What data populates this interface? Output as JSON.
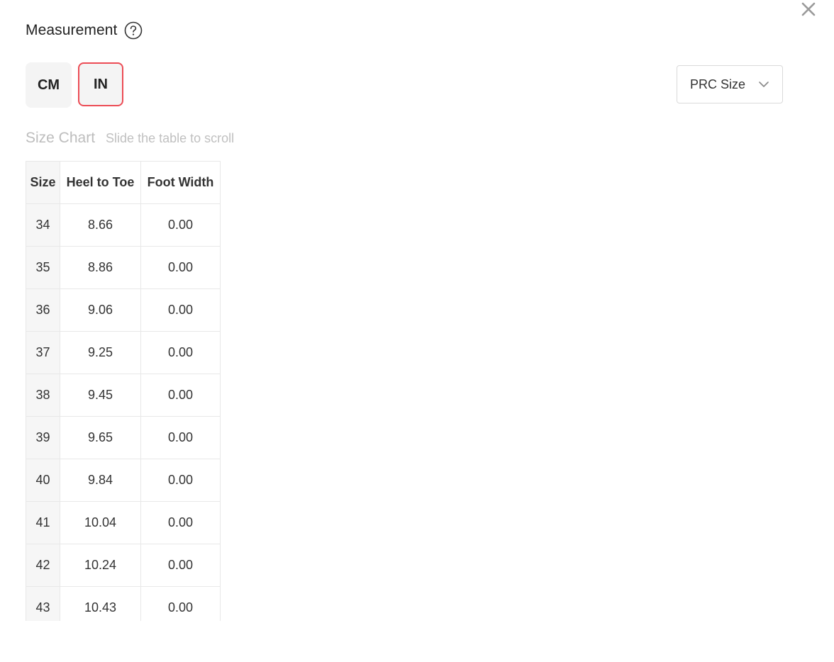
{
  "header": {
    "title": "Measurement",
    "help_icon": "question-circle-icon",
    "close_icon": "close-icon"
  },
  "units": {
    "options": [
      {
        "label": "CM",
        "selected": false
      },
      {
        "label": "IN",
        "selected": true
      }
    ],
    "selected_border_color": "#ec4c55"
  },
  "size_select": {
    "value": "PRC Size",
    "icon": "chevron-down-icon"
  },
  "size_chart": {
    "title": "Size Chart",
    "hint": "Slide the table to scroll",
    "columns": [
      "Size",
      "Heel to Toe",
      "Foot Width"
    ],
    "rows": [
      [
        "34",
        "8.66",
        "0.00"
      ],
      [
        "35",
        "8.86",
        "0.00"
      ],
      [
        "36",
        "9.06",
        "0.00"
      ],
      [
        "37",
        "9.25",
        "0.00"
      ],
      [
        "38",
        "9.45",
        "0.00"
      ],
      [
        "39",
        "9.65",
        "0.00"
      ],
      [
        "40",
        "9.84",
        "0.00"
      ],
      [
        "41",
        "10.04",
        "0.00"
      ],
      [
        "42",
        "10.24",
        "0.00"
      ],
      [
        "43",
        "10.43",
        "0.00"
      ]
    ]
  }
}
